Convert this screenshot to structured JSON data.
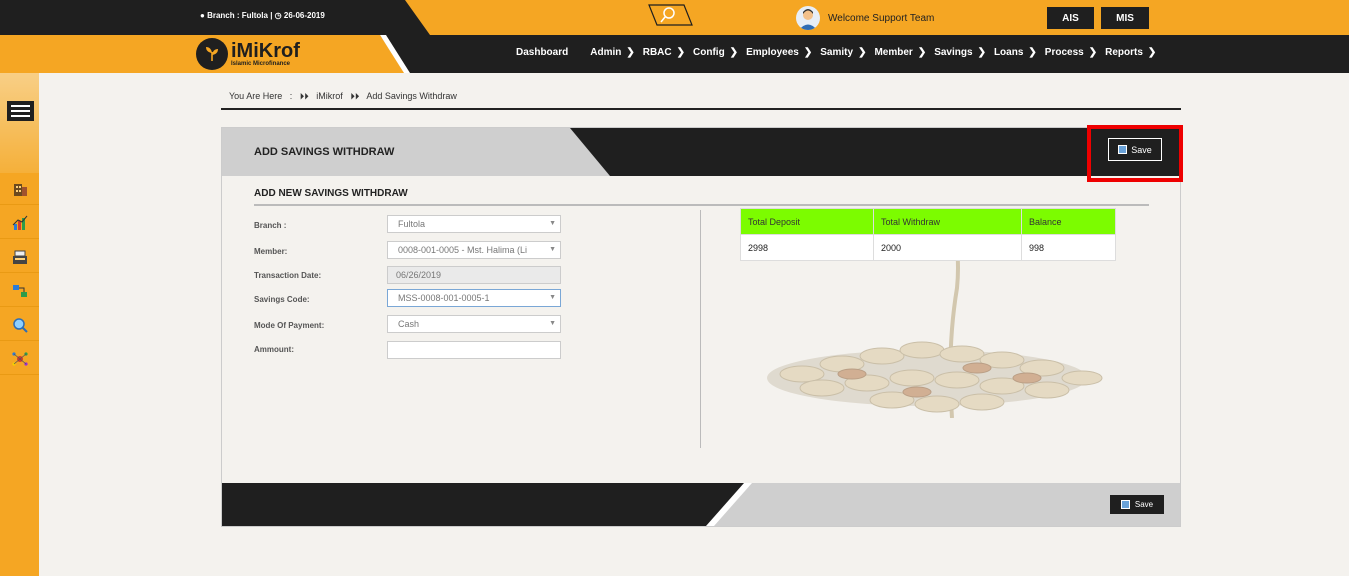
{
  "top": {
    "branch_info": "Branch : Fultola |",
    "date": "26-06-2019",
    "welcome": "Welcome Support Team",
    "buttons": [
      "AIS",
      "MIS"
    ]
  },
  "logo": {
    "name": "iMiKrof",
    "tagline": "Islamic Microfinance"
  },
  "nav": [
    "Dashboard",
    "Admin",
    "RBAC",
    "Config",
    "Employees",
    "Samity",
    "Member",
    "Savings",
    "Loans",
    "Process",
    "Reports"
  ],
  "breadcrumb": {
    "label": "You Are Here",
    "sep": ":",
    "items": [
      "iMikrof",
      "Add Savings Withdraw"
    ]
  },
  "panel": {
    "title": "ADD SAVINGS WITHDRAW",
    "save_label": "Save",
    "subtitle": "ADD NEW SAVINGS WITHDRAW",
    "fields": [
      {
        "label": "Branch :",
        "value": "Fultola"
      },
      {
        "label": "Member:",
        "value": "0008-001-0005 - Mst. Halima (Li"
      },
      {
        "label": "Transaction Date:",
        "value": "06/26/2019"
      },
      {
        "label": "Savings Code:",
        "value": "MSS-0008-001-0005-1"
      },
      {
        "label": "Mode Of Payment:",
        "value": "Cash"
      },
      {
        "label": "Ammount:",
        "value": ""
      }
    ],
    "summary": {
      "headers": [
        "Total Deposit",
        "Total Withdraw",
        "Balance"
      ],
      "values": [
        "2998",
        "2000",
        "998"
      ]
    }
  },
  "colors": {
    "accent": "#f5a623",
    "dark": "#1f1f1f",
    "summary_header": "#7cfc00",
    "highlight": "#ee0000"
  },
  "icons": [
    "search-icon",
    "user-avatar-icon",
    "menu-icon",
    "building-icon",
    "chart-icon",
    "register-icon",
    "transfer-icon",
    "search-person-icon",
    "network-icon",
    "save-icon"
  ]
}
